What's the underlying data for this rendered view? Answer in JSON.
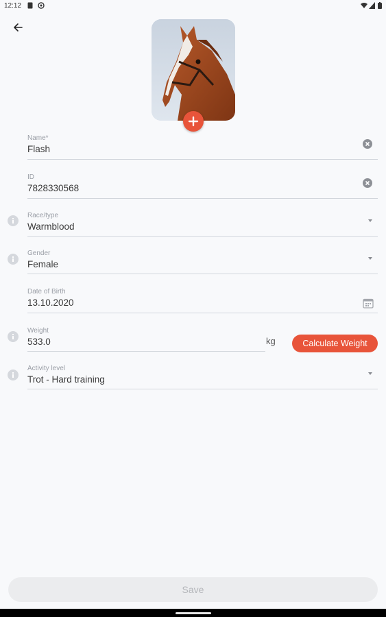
{
  "status": {
    "time": "12:12",
    "icons": [
      "sim-icon",
      "vpn-icon",
      "wifi-icon",
      "signal-icon",
      "battery-icon"
    ]
  },
  "header": {
    "back_icon": "arrow-left-icon"
  },
  "photo": {
    "alt": "horse photo",
    "add_icon": "plus-icon"
  },
  "form": {
    "name": {
      "label": "Name*",
      "value": "Flash",
      "trailing_icon": "clear-icon"
    },
    "id": {
      "label": "ID",
      "value": "7828330568",
      "trailing_icon": "clear-icon"
    },
    "race": {
      "label": "Race/type",
      "value": "Warmblood",
      "trailing_icon": "dropdown-icon"
    },
    "gender": {
      "label": "Gender",
      "value": "Female",
      "trailing_icon": "dropdown-icon"
    },
    "dob": {
      "label": "Date of Birth",
      "value": "13.10.2020",
      "trailing_icon": "calendar-icon"
    },
    "weight": {
      "label": "Weight",
      "value": "533.0",
      "unit": "kg"
    },
    "activity": {
      "label": "Activity level",
      "value": "Trot - Hard training",
      "trailing_icon": "dropdown-icon"
    }
  },
  "actions": {
    "calculate_weight": "Calculate Weight",
    "save": "Save"
  },
  "colors": {
    "accent": "#e8543a",
    "background": "#f8f9fb",
    "disabled": "#ebecee"
  }
}
